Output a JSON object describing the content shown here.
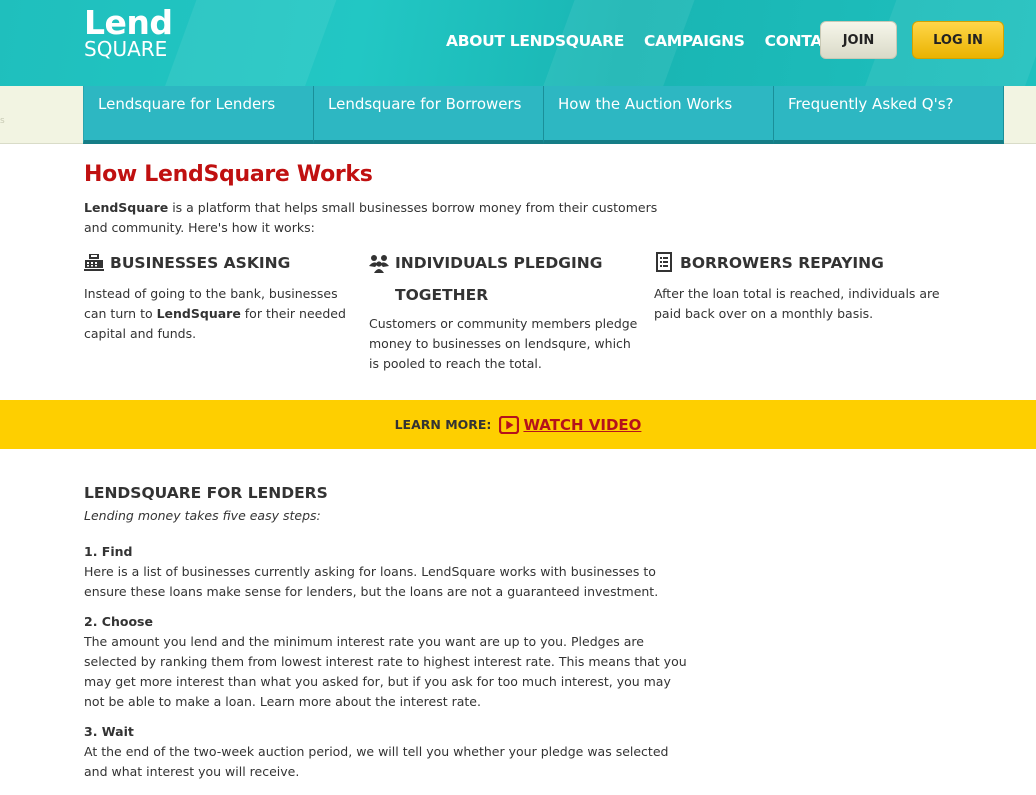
{
  "header": {
    "logo_top": "Lend",
    "logo_bottom": "SQUARE",
    "nav": [
      "ABOUT LENDSQUARE",
      "CAMPAIGNS",
      "CONTACT"
    ],
    "join_label": "JOIN",
    "login_label": "LOG IN"
  },
  "subnav": {
    "tabs": [
      "Lendsquare for Lenders",
      "Lendsquare for Borrowers",
      "How the Auction Works",
      "Frequently Asked Q's?"
    ],
    "left_mark": "s"
  },
  "how": {
    "title": "How LendSquare Works",
    "intro_brand": "LendSquare",
    "intro_rest": " is a platform that helps small businesses borrow money from their customers and community. Here's how it works:",
    "columns": [
      {
        "heading": "BUSINESSES ASKING",
        "icon": "cash-register-icon",
        "text_before": "Instead of going to the bank, businesses can turn to ",
        "text_bold": "LendSquare",
        "text_after": " for their needed capital and funds."
      },
      {
        "heading_line1": "INDIVIDUALS PLEDGING",
        "heading_line2": "TOGETHER",
        "icon": "people-icon",
        "text": "Customers or community members pledge money to businesses on lendsqure, which is pooled to reach the total."
      },
      {
        "heading": "BORROWERS REPAYING",
        "icon": "receipt-icon",
        "text": "After the loan total is reached, individuals are paid back over on a monthly basis."
      }
    ]
  },
  "band": {
    "learn_more": "LEARN MORE:",
    "watch_video": "WATCH VIDEO",
    "play_icon": "play-icon"
  },
  "lenders": {
    "heading": "LENDSQUARE FOR LENDERS",
    "subheading": "Lending money takes five easy steps:",
    "steps": [
      {
        "title": "1. Find",
        "text": "Here is a list of businesses currently asking for loans. LendSquare works with businesses to ensure these loans make sense for lenders, but the loans are not a guaranteed investment."
      },
      {
        "title": "2. Choose",
        "text": "The amount you lend and the minimum interest rate you want are up to you. Pledges are selected by ranking them from lowest interest rate to highest interest rate. This means that you may get more interest than what you asked for, but if you ask for too much interest, you may not be able to make a loan. Learn more about the interest rate."
      },
      {
        "title": "3. Wait",
        "text": "At the end of the two-week auction period, we will tell you whether your pledge was selected and what interest you will receive."
      }
    ]
  },
  "colors": {
    "header_teal": "#1fbfbd",
    "tab_teal": "#2db7c2",
    "title_red": "#c01010",
    "band_yellow": "#fecf00",
    "login_yellow": "#eab300"
  }
}
